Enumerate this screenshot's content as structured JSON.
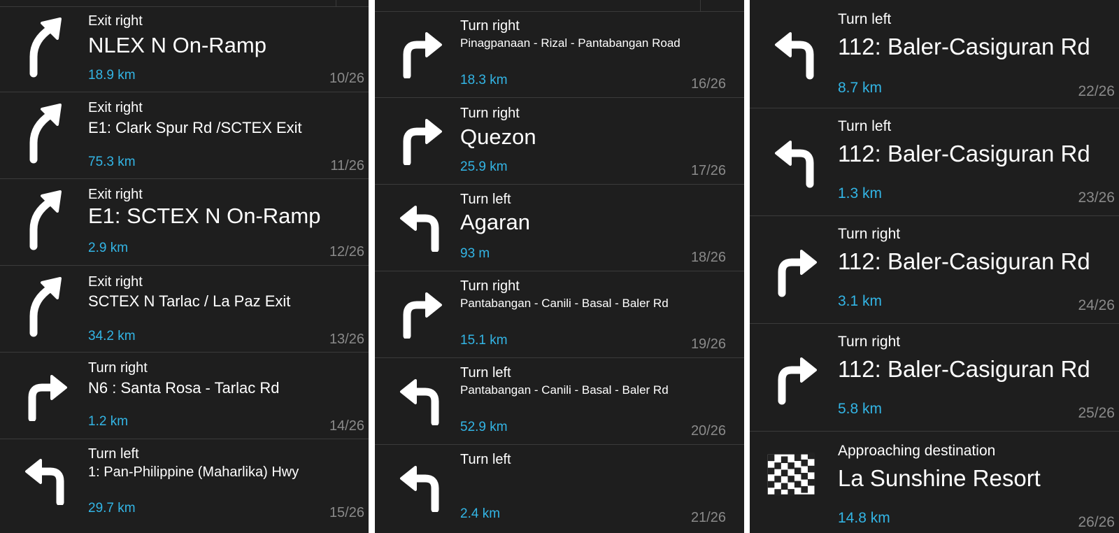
{
  "colors": {
    "background": "#1e1e1e",
    "text": "#ffffff",
    "distance": "#33b5e5",
    "counter": "#8a8a8a",
    "divider": "#3b3b3b"
  },
  "panels": [
    {
      "items": [
        {
          "icon": "exit-right-arrow-icon",
          "instruction": "Exit right",
          "street": "NLEX N On-Ramp",
          "distance": "18.9 km",
          "counter": "10/26"
        },
        {
          "icon": "exit-right-arrow-icon",
          "instruction": "Exit right",
          "street": "E1: Clark Spur Rd /SCTEX Exit",
          "distance": "75.3 km",
          "counter": "11/26"
        },
        {
          "icon": "exit-right-arrow-icon",
          "instruction": "Exit right",
          "street": "E1: SCTEX N On-Ramp",
          "distance": "2.9 km",
          "counter": "12/26"
        },
        {
          "icon": "exit-right-arrow-icon",
          "instruction": "Exit right",
          "street": "SCTEX N Tarlac / La Paz Exit",
          "distance": "34.2 km",
          "counter": "13/26"
        },
        {
          "icon": "turn-right-arrow-icon",
          "instruction": "Turn right",
          "street": "N6 : Santa Rosa - Tarlac Rd",
          "distance": "1.2 km",
          "counter": "14/26"
        },
        {
          "icon": "turn-left-arrow-icon",
          "instruction": "Turn left",
          "street": "1: Pan-Philippine (Maharlika) Hwy",
          "distance": "29.7 km",
          "counter": "15/26"
        }
      ]
    },
    {
      "items": [
        {
          "icon": "turn-right-arrow-icon",
          "instruction": "Turn right",
          "street": "Pinagpanaan - Rizal - Pantabangan Road",
          "distance": "18.3 km",
          "counter": "16/26"
        },
        {
          "icon": "turn-right-arrow-icon",
          "instruction": "Turn right",
          "street": "Quezon",
          "distance": "25.9 km",
          "counter": "17/26"
        },
        {
          "icon": "turn-left-arrow-icon",
          "instruction": "Turn left",
          "street": "Agaran",
          "distance": "93 m",
          "counter": "18/26"
        },
        {
          "icon": "turn-right-arrow-icon",
          "instruction": "Turn right",
          "street": "Pantabangan - Canili - Basal - Baler Rd",
          "distance": "15.1 km",
          "counter": "19/26"
        },
        {
          "icon": "turn-left-arrow-icon",
          "instruction": "Turn left",
          "street": "Pantabangan - Canili - Basal - Baler Rd",
          "distance": "52.9 km",
          "counter": "20/26"
        },
        {
          "icon": "turn-left-arrow-icon",
          "instruction": "Turn left",
          "street": "",
          "distance": "2.4 km",
          "counter": "21/26"
        }
      ]
    },
    {
      "items": [
        {
          "icon": "turn-left-arrow-icon",
          "instruction": "Turn left",
          "street": "112: Baler-Casiguran Rd",
          "distance": "8.7 km",
          "counter": "22/26"
        },
        {
          "icon": "turn-left-arrow-icon",
          "instruction": "Turn left",
          "street": "112: Baler-Casiguran Rd",
          "distance": "1.3 km",
          "counter": "23/26"
        },
        {
          "icon": "turn-right-arrow-icon",
          "instruction": "Turn right",
          "street": "112: Baler-Casiguran Rd",
          "distance": "3.1 km",
          "counter": "24/26"
        },
        {
          "icon": "turn-right-arrow-icon",
          "instruction": "Turn right",
          "street": "112: Baler-Casiguran Rd",
          "distance": "5.8 km",
          "counter": "25/26"
        },
        {
          "icon": "checkered-flag-icon",
          "instruction": "Approaching destination",
          "street": "La Sunshine Resort",
          "distance": "14.8 km",
          "counter": "26/26"
        }
      ]
    }
  ]
}
